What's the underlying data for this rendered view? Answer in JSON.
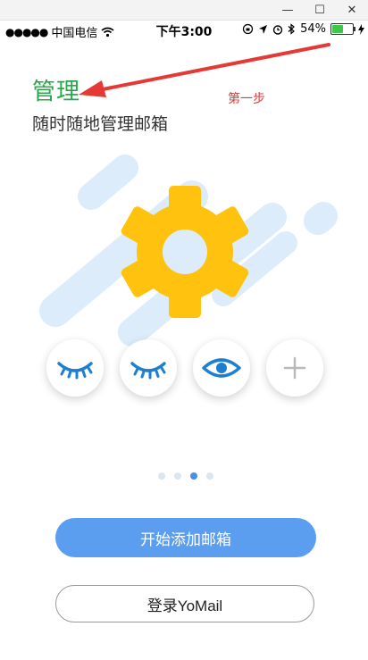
{
  "window": {
    "minimize_glyph": "—",
    "maximize_glyph": "☐",
    "close_glyph": "✕"
  },
  "status_bar": {
    "signal": "●●●●●",
    "carrier": "中国电信",
    "time": "下午3:00",
    "battery_percent": "54%",
    "battery_level": 0.54,
    "icons": [
      "wifi-icon",
      "rotation-lock-icon",
      "location-icon",
      "alarm-icon",
      "bluetooth-icon",
      "charging-icon"
    ]
  },
  "onboarding": {
    "title": "管理",
    "subtitle": "随时随地管理邮箱",
    "annotation": "第一步",
    "page_count": 4,
    "active_page": 3
  },
  "actions": {
    "primary_label": "开始添加邮箱",
    "secondary_label": "登录YoMail"
  },
  "colors": {
    "title_green": "#27a84a",
    "annotation_red": "#e03a3a",
    "primary_blue": "#5b9ef0",
    "gear_yellow": "#ffc20e",
    "eye_blue": "#1e7fd0"
  }
}
